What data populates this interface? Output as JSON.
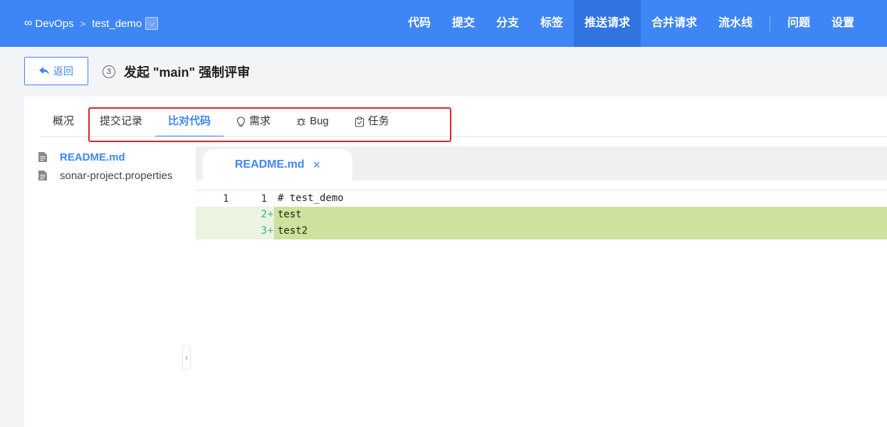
{
  "topbar": {
    "logo_icon": "∞",
    "app_name": "DevOps",
    "separator": ">",
    "repo": "test_demo",
    "nav": [
      "代码",
      "提交",
      "分支",
      "标签",
      "推送请求",
      "合并请求",
      "流水线",
      "问题",
      "设置"
    ],
    "active_nav": "推送请求",
    "bg_color": "#3e86f5"
  },
  "header": {
    "back_label": "返回",
    "step_number": "3",
    "title": "发起 \"main\" 强制评审"
  },
  "tabs": {
    "overview": "概况",
    "commits": "提交记录",
    "diff": "比对代码",
    "requirements": "需求",
    "bug": "Bug",
    "tasks": "任务"
  },
  "files": [
    {
      "name": "README.md",
      "active": true
    },
    {
      "name": "sonar-project.properties",
      "active": false
    }
  ],
  "diff": {
    "file_tab": "README.md",
    "close_glyph": "×",
    "lines": [
      {
        "old": "1",
        "new": "1",
        "mark": "",
        "code": "# test_demo",
        "type": "context"
      },
      {
        "old": "",
        "new": "2",
        "mark": "+",
        "code": "test",
        "type": "add"
      },
      {
        "old": "",
        "new": "3",
        "mark": "+",
        "code": "test2",
        "type": "add"
      }
    ]
  }
}
